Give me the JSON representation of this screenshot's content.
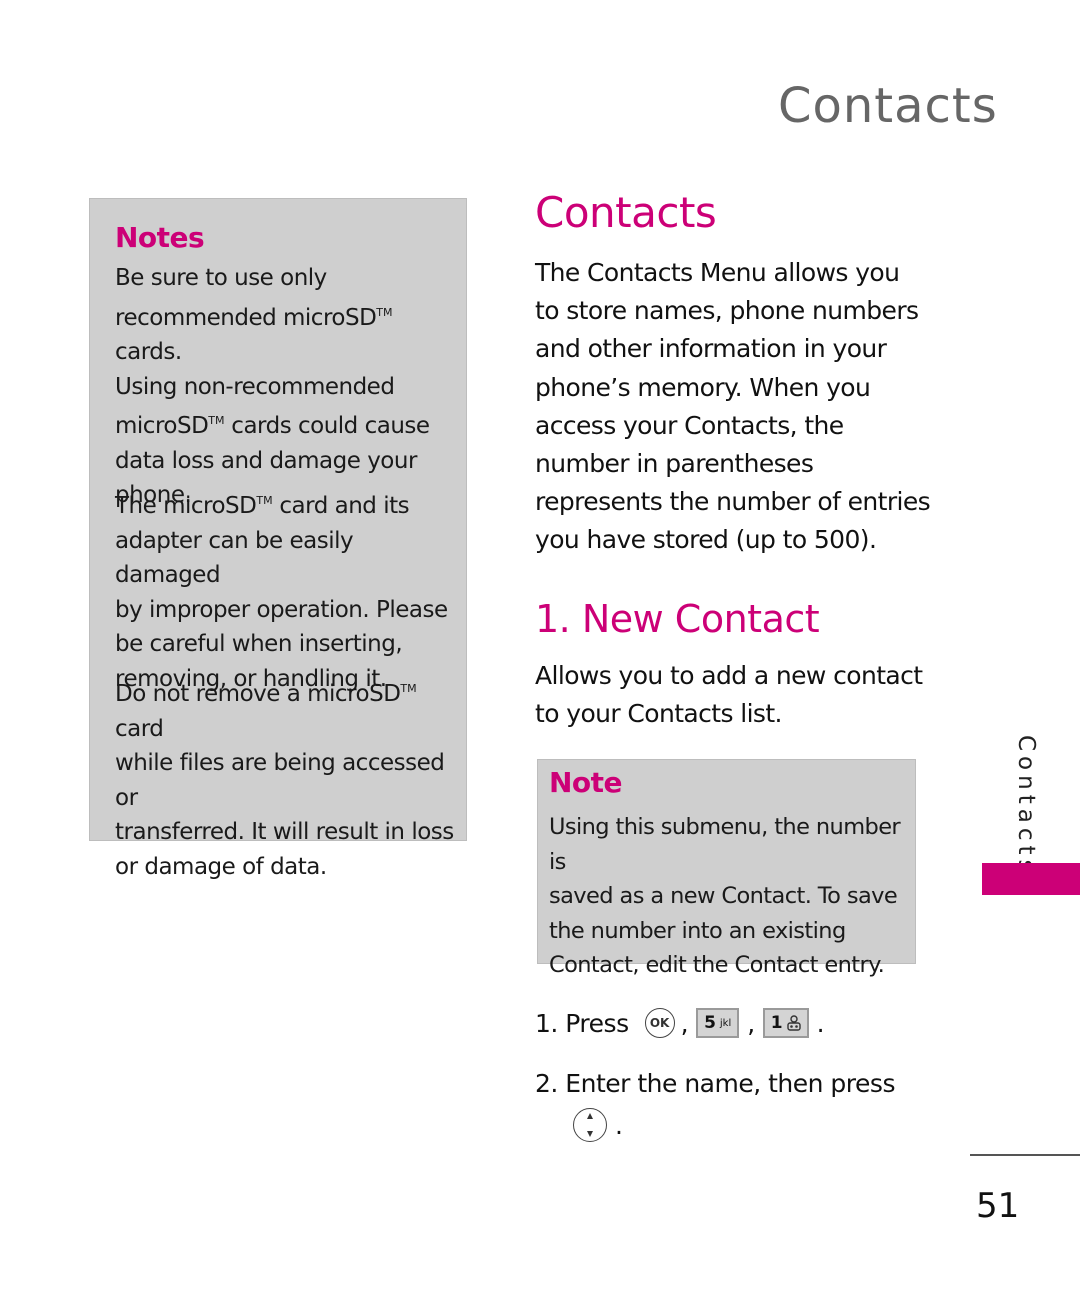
{
  "page": {
    "running_header": "Contacts",
    "side_tab_label": "Contacts",
    "page_number": "51",
    "accent_color": "#cc0077"
  },
  "notes_box": {
    "title": "Notes",
    "paragraphs": [
      {
        "lines": [
          "Be sure to use only",
          "recommended microSD",
          " cards.",
          "Using non-recommended",
          "microSD",
          " cards could cause",
          "data loss and damage your",
          "phone."
        ]
      },
      {
        "lines": [
          "The microSD",
          " card and its",
          "adapter can be easily damaged",
          "by improper operation. Please",
          "be careful when inserting,",
          "removing, or handling it."
        ]
      },
      {
        "lines": [
          "Do not remove a microSD",
          " card",
          "while files are being accessed or",
          "transferred. It will result in loss",
          "or damage of data."
        ]
      }
    ],
    "trademark": "TM"
  },
  "main": {
    "section_title": "Contacts",
    "intro_lines": [
      "The Contacts Menu allows you",
      "to store names, phone numbers",
      "and other information in your",
      "phone’s memory. When you",
      "access your Contacts, the",
      "number in parentheses",
      "represents the number of entries",
      "you have stored (up to 500)."
    ],
    "subsection_title": "1. New Contact",
    "subsection_lines": [
      "Allows you to add a new contact",
      "to your Contacts list."
    ],
    "note": {
      "title": "Note",
      "lines": [
        "Using this submenu, the number is",
        "saved as a new Contact. To save",
        "the number into an existing",
        "Contact, edit the Contact entry."
      ]
    },
    "steps": [
      {
        "prefix": "1. Press",
        "keys": [
          {
            "type": "ok-key",
            "label": "OK"
          },
          {
            "type": "number-key",
            "label": "5",
            "sub": "jkl"
          },
          {
            "type": "number-key",
            "label": "1",
            "sub": "voicemail-icon"
          }
        ]
      },
      {
        "prefix": "2. Enter the name, then press",
        "keys": [
          {
            "type": "nav-key",
            "label": "up-down-navigation-icon"
          }
        ]
      }
    ]
  }
}
